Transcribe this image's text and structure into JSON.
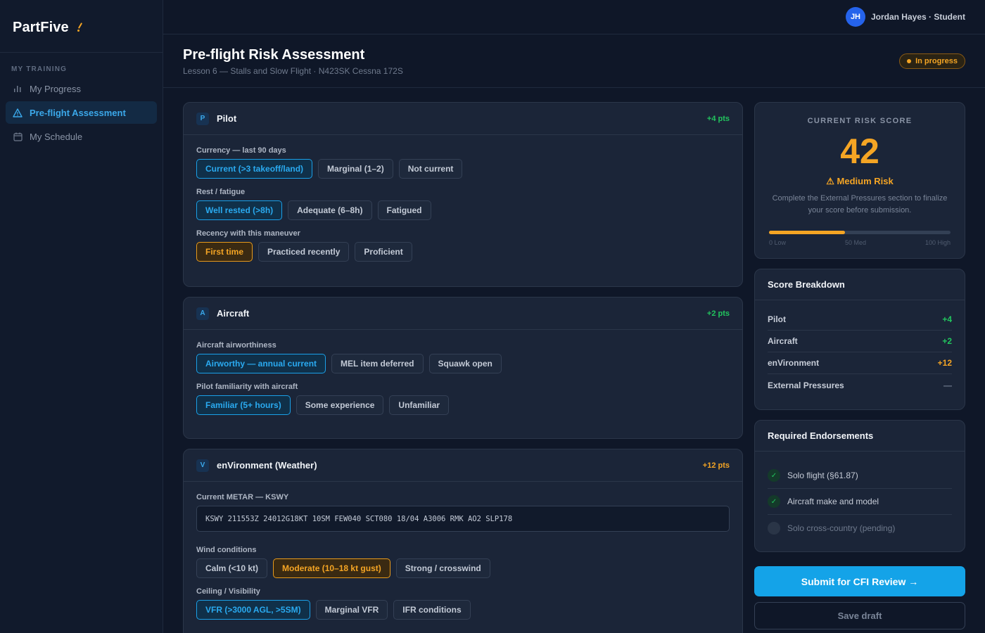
{
  "app": {
    "name": "PartFive"
  },
  "user": {
    "initials": "JH",
    "name": "Jordan Hayes · Student"
  },
  "sidebar": {
    "section_label": "MY TRAINING",
    "items": [
      {
        "label": "My Progress",
        "icon": "bar-chart-icon"
      },
      {
        "label": "Pre-flight Assessment",
        "icon": "warning-triangle-icon",
        "active": true
      },
      {
        "label": "My Schedule",
        "icon": "calendar-icon"
      }
    ]
  },
  "header": {
    "title": "Pre-flight Risk Assessment",
    "subtitle": "Lesson 6 — Stalls and Slow Flight · N423SK Cessna 172S",
    "status": "In progress"
  },
  "sections": {
    "pilot": {
      "letter": "P",
      "title": "Pilot",
      "points": "+4 pts",
      "questions": [
        {
          "label": "Currency — last 90 days",
          "options": [
            "Current (>3 takeoff/land)",
            "Marginal (1–2)",
            "Not current"
          ],
          "selected": 0
        },
        {
          "label": "Rest / fatigue",
          "options": [
            "Well rested (>8h)",
            "Adequate (6–8h)",
            "Fatigued"
          ],
          "selected": 0
        },
        {
          "label": "Recency with this maneuver",
          "options": [
            "First time",
            "Practiced recently",
            "Proficient"
          ],
          "selected": 0
        }
      ]
    },
    "aircraft": {
      "letter": "A",
      "title": "Aircraft",
      "points": "+2 pts",
      "questions": [
        {
          "label": "Aircraft airworthiness",
          "options": [
            "Airworthy — annual current",
            "MEL item deferred",
            "Squawk open"
          ],
          "selected": 0
        },
        {
          "label": "Pilot familiarity with aircraft",
          "options": [
            "Familiar (5+ hours)",
            "Some experience",
            "Unfamiliar"
          ],
          "selected": 0
        }
      ]
    },
    "environment": {
      "letter": "V",
      "title": "enVironment (Weather)",
      "points": "+12 pts",
      "metar_label": "Current METAR — KSWY",
      "metar": "KSWY 211553Z 24012G18KT 10SM FEW040 SCT080 18/04 A3006 RMK AO2 SLP178",
      "questions": [
        {
          "label": "Wind conditions",
          "options": [
            "Calm (<10 kt)",
            "Moderate (10–18 kt gust)",
            "Strong / crosswind"
          ],
          "selected": 1
        },
        {
          "label": "Ceiling / Visibility",
          "options": [
            "VFR (>3000 AGL, >5SM)",
            "Marginal VFR",
            "IFR conditions"
          ],
          "selected": 0
        }
      ]
    }
  },
  "risk": {
    "label": "CURRENT RISK SCORE",
    "score": "42",
    "score_value": 42,
    "level": "⚠ Medium Risk",
    "note": "Complete the External Pressures section to finalize your score before submission.",
    "scale": [
      "0 Low",
      "50 Med",
      "100 High"
    ]
  },
  "breakdown": {
    "title": "Score Breakdown",
    "rows": [
      {
        "name": "Pilot",
        "value": "+4"
      },
      {
        "name": "Aircraft",
        "value": "+2"
      },
      {
        "name": "enVironment",
        "value": "+12"
      },
      {
        "name": "External Pressures",
        "value": "—"
      }
    ]
  },
  "endorsements": {
    "title": "Required Endorsements",
    "items": [
      {
        "label": "Solo flight (§61.87)",
        "done": true
      },
      {
        "label": "Aircraft make and model",
        "done": true
      },
      {
        "label": "Solo cross-country (pending)",
        "done": false
      }
    ]
  },
  "actions": {
    "submit": "Submit for CFI Review →",
    "draft": "Save draft"
  },
  "colors": {
    "accent": "#14a3e8",
    "warning": "#f5a524",
    "success": "#22c55e",
    "background": "#0f1728"
  }
}
